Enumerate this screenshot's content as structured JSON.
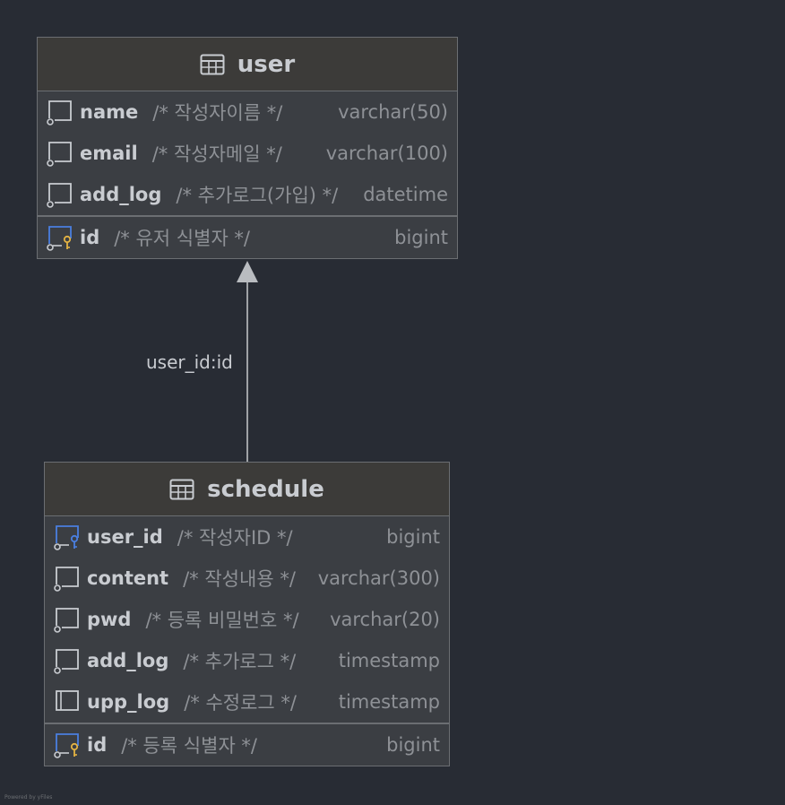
{
  "tables": {
    "user": {
      "title": "user",
      "fields": [
        {
          "name": "name",
          "comment": "/* 작성자이름 */",
          "type": "varchar(50)"
        },
        {
          "name": "email",
          "comment": "/* 작성자메일 */",
          "type": "varchar(100)"
        },
        {
          "name": "add_log",
          "comment": "/* 추가로그(가입) */",
          "type": "datetime"
        }
      ],
      "keys": [
        {
          "name": "id",
          "comment": "/* 유저 식별자 */",
          "type": "bigint"
        }
      ]
    },
    "schedule": {
      "title": "schedule",
      "fields": [
        {
          "name": "user_id",
          "comment": "/* 작성자ID */",
          "type": "bigint"
        },
        {
          "name": "content",
          "comment": "/* 작성내용 */",
          "type": "varchar(300)"
        },
        {
          "name": "pwd",
          "comment": "/* 등록 비밀번호 */",
          "type": "varchar(20)"
        },
        {
          "name": "add_log",
          "comment": "/* 추가로그 */",
          "type": "timestamp"
        },
        {
          "name": "upp_log",
          "comment": "/* 수정로그 */",
          "type": "timestamp"
        }
      ],
      "keys": [
        {
          "name": "id",
          "comment": "/* 등록 식별자 */",
          "type": "bigint"
        }
      ]
    }
  },
  "relationship": {
    "label": "user_id:id"
  },
  "footer": {
    "text": "Powered by yFiles"
  },
  "colors": {
    "background": "#282c34",
    "table_body": "#3b3e43",
    "table_header": "#3c3b39",
    "border": "#6b6e72",
    "text": "#c9ccd1",
    "muted_text": "#8e9196",
    "foreign_key": "#4a7fe0",
    "primary_key": "#e4b343"
  }
}
